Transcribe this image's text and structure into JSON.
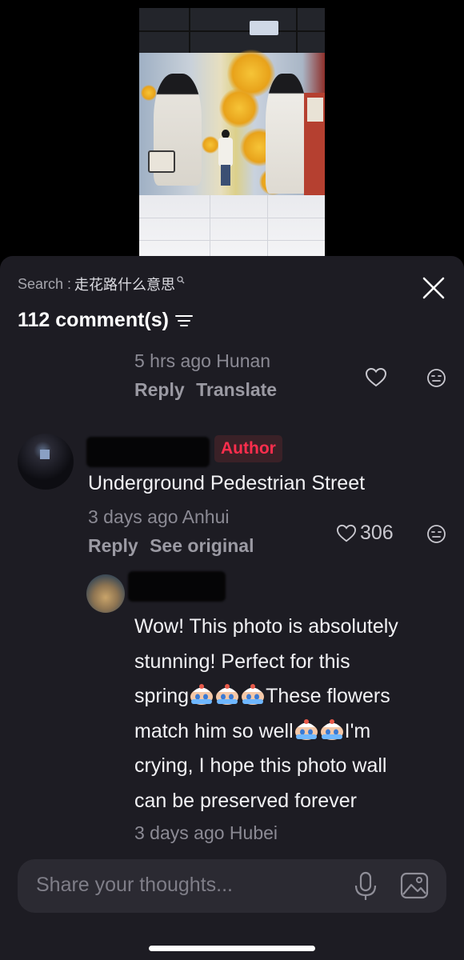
{
  "search": {
    "prefix": "Search : ",
    "term": "走花路什么意思"
  },
  "header": {
    "comment_count": "112 comment(s)"
  },
  "comments": [
    {
      "time": "5 hrs ago",
      "location": "Hunan",
      "reply_label": "Reply",
      "translate_label": "Translate"
    },
    {
      "badge": "Author",
      "text": "Underground Pedestrian Street",
      "time": "3 days ago",
      "location": "Anhui",
      "likes": "306",
      "reply_label": "Reply",
      "see_original_label": "See original"
    }
  ],
  "reply": {
    "lines": [
      "Wow! This photo is absolutely",
      "stunning! Perfect for this",
      "spring",
      "These flowers",
      "match him so well",
      "I'm",
      "crying, I hope this photo wall",
      "can be preserved forever"
    ],
    "time": "3 days ago",
    "location": "Hubei"
  },
  "input": {
    "placeholder": "Share your thoughts..."
  },
  "colors": {
    "accent": "#ff2e4d",
    "sheet_bg": "#1d1c23"
  }
}
